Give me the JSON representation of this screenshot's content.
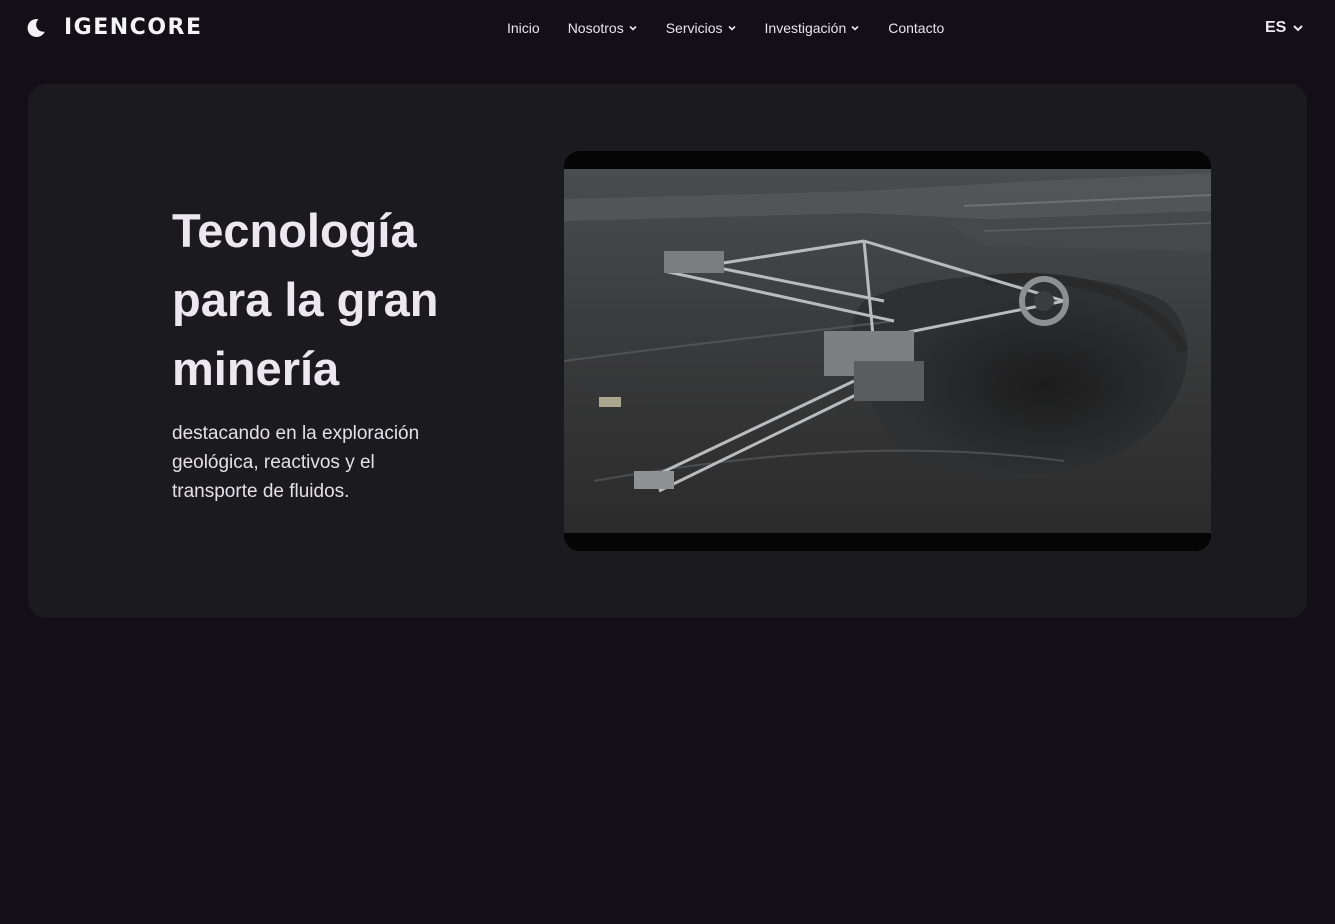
{
  "header": {
    "logo_text": "IGENCORE",
    "theme_icon": "moon-icon",
    "nav": [
      {
        "label": "Inicio",
        "has_dropdown": false
      },
      {
        "label": "Nosotros",
        "has_dropdown": true
      },
      {
        "label": "Servicios",
        "has_dropdown": true
      },
      {
        "label": "Investigación",
        "has_dropdown": true
      },
      {
        "label": "Contacto",
        "has_dropdown": false
      }
    ],
    "language": "ES"
  },
  "hero": {
    "title": "Tecnología para la gran minería",
    "subtitle": "destacando en la exploración geológica, reactivos y el transporte de fluidos.",
    "media": "mining-excavator-video"
  },
  "colors": {
    "background": "#121016",
    "card": "#1b1a1f",
    "text": "#ebe8ef"
  }
}
